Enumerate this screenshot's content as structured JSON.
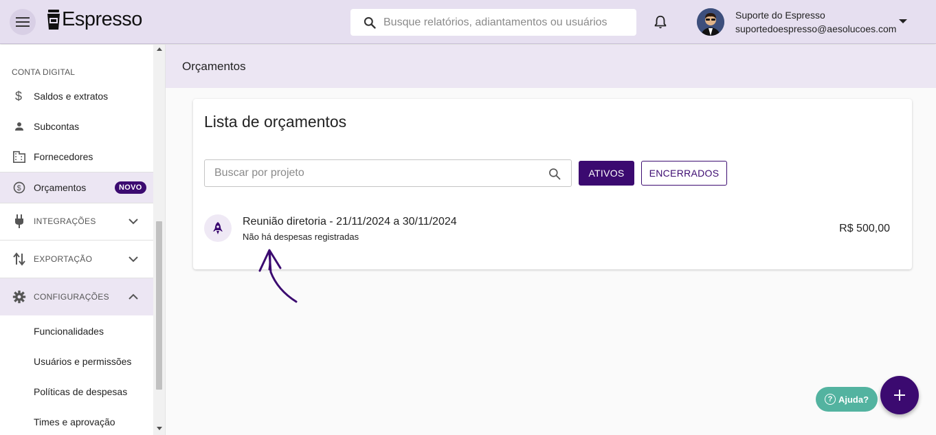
{
  "header": {
    "logo_text": "Espresso",
    "search_placeholder": "Busque relatórios, adiantamentos ou usuários",
    "user_name": "Suporte do Espresso",
    "user_email": "suportedoespresso@aesolucoes.com"
  },
  "sidebar": {
    "section_title": "CONTA DIGITAL",
    "items": [
      {
        "label": "Saldos e extratos",
        "icon": "dollar-icon"
      },
      {
        "label": "Subcontas",
        "icon": "person-icon"
      },
      {
        "label": "Fornecedores",
        "icon": "building-icon"
      },
      {
        "label": "Orçamentos",
        "icon": "budget-icon",
        "badge": "NOVO"
      }
    ],
    "groups": [
      {
        "label": "INTEGRAÇÕES",
        "icon": "plug-icon",
        "expanded": false
      },
      {
        "label": "EXPORTAÇÃO",
        "icon": "export-icon",
        "expanded": false
      },
      {
        "label": "CONFIGURAÇÕES",
        "icon": "gear-icon",
        "expanded": true
      }
    ],
    "sub_items": [
      "Funcionalidades",
      "Usuários e permissões",
      "Políticas de despesas",
      "Times e aprovação"
    ]
  },
  "page": {
    "title": "Orçamentos",
    "card_title": "Lista de orçamentos",
    "search_placeholder": "Buscar por projeto",
    "btn_active": "ATIVOS",
    "btn_closed": "ENCERRADOS",
    "rows": [
      {
        "title": "Reunião diretoria - 21/11/2024 a 30/11/2024",
        "subtitle": "Não há despesas registradas",
        "value": "R$ 500,00"
      }
    ]
  },
  "help_label": "Ajuda?",
  "colors": {
    "primary": "#3b0a70",
    "header_bg": "#e6dff0",
    "help": "#53b3a0"
  }
}
